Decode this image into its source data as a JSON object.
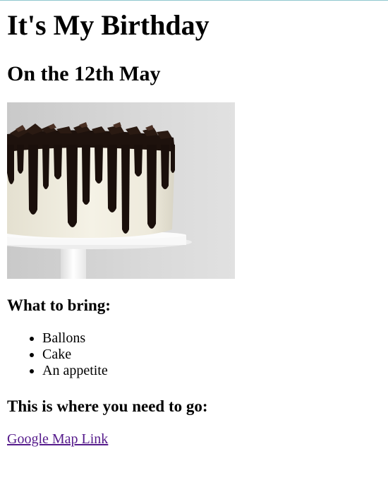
{
  "page": {
    "title": "It's My Birthday",
    "date": "On the 12th May",
    "cake_image": {
      "description": "photo of a white frosted cake with dripping chocolate ganache on a white cake stand",
      "colors": {
        "background": "#d6d6d6",
        "frosting": "#f2efe3",
        "chocolate": "#1c100c",
        "stand": "#f7f7f7"
      }
    },
    "bring_heading": "What to bring:",
    "bring_items": [
      "Ballons",
      "Cake",
      "An appetite"
    ],
    "directions_heading": "This is where you need to go:",
    "map_link_label": "Google Map Link",
    "link_color": "#551a8b"
  }
}
